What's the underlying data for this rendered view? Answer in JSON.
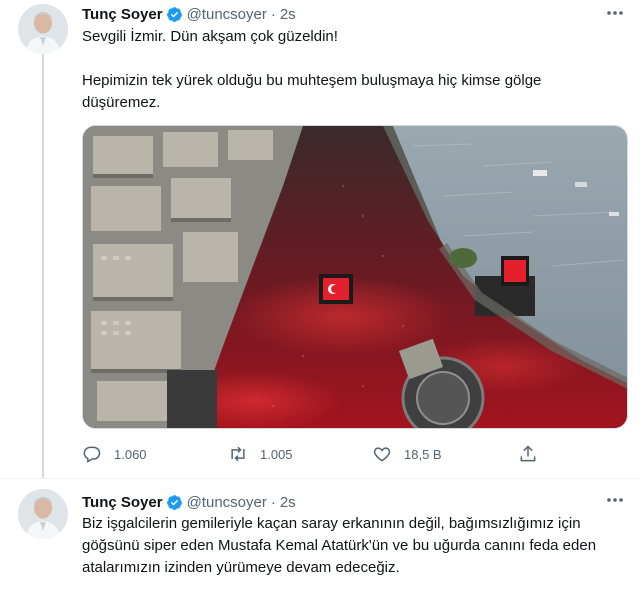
{
  "tweets": [
    {
      "author": {
        "name": "Tunç Soyer",
        "handle": "@tuncsoyer",
        "verified": true
      },
      "time": "2s",
      "paragraphs": [
        "Sevgili İzmir. Dün akşam çok güzeldin!",
        "Hepimizin tek yürek olduğu bu muhteşem buluşmaya hiç kimse gölge düşüremez."
      ],
      "stats": {
        "replies": "1.060",
        "retweets": "1.005",
        "likes": "18,5 B"
      }
    },
    {
      "author": {
        "name": "Tunç Soyer",
        "handle": "@tuncsoyer",
        "verified": true
      },
      "time": "2s",
      "paragraphs": [
        "Biz işgalcilerin gemileriyle kaçan saray erkanının değil, bağımsızlığımız için göğsünü siper eden Mustafa Kemal Atatürk'ün ve bu uğurda canını feda eden atalarımızın izinden yürümeye devam edeceğiz."
      ]
    }
  ],
  "icons": [
    "verified-badge-icon",
    "more-icon",
    "reply-icon",
    "retweet-icon",
    "like-icon",
    "share-icon"
  ],
  "colors": {
    "verified": "#1d9bf0",
    "text": "#0f1419",
    "secondary": "#536471",
    "crowd_red": "#c0182a",
    "sea": "#8a9aa3"
  }
}
